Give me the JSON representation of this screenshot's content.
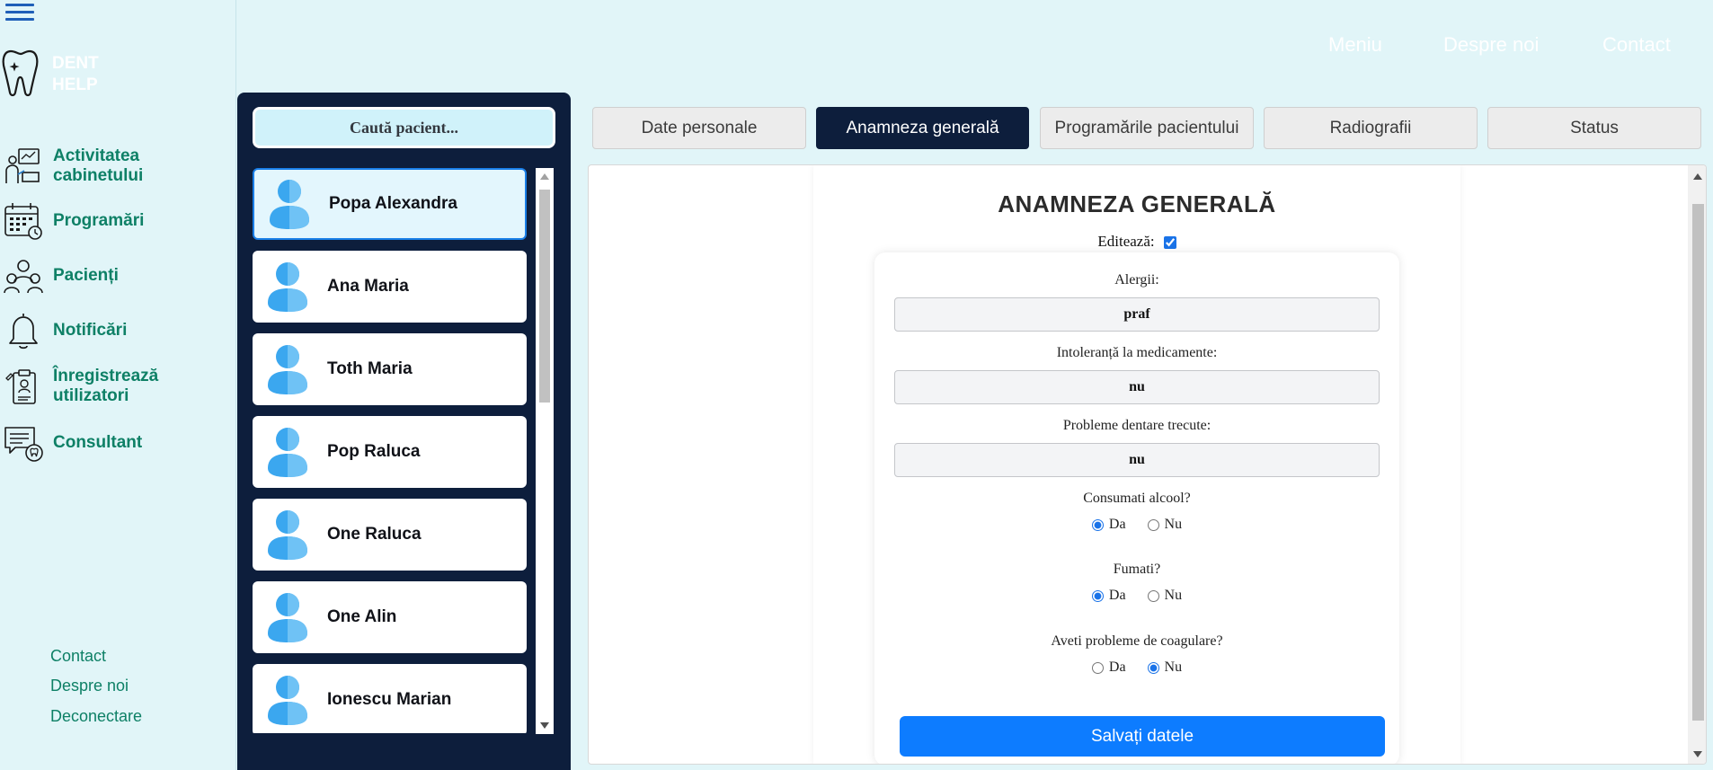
{
  "app": {
    "logo_line1": "DENT",
    "logo_line2": "HELP"
  },
  "topnav": {
    "menu": "Meniu",
    "about": "Despre noi",
    "contact": "Contact"
  },
  "sidebar": {
    "items": [
      {
        "label": "Activitatea cabinetului",
        "icon": "clinic-activity-icon"
      },
      {
        "label": "Programări",
        "icon": "calendar-icon"
      },
      {
        "label": "Pacienți",
        "icon": "patients-icon"
      },
      {
        "label": "Notificări",
        "icon": "bell-icon"
      },
      {
        "label": "Înregistrează utilizatori",
        "icon": "register-users-icon"
      },
      {
        "label": "Consultant",
        "icon": "consultant-icon"
      }
    ],
    "footer_links": [
      "Contact",
      "Despre noi",
      "Deconectare"
    ]
  },
  "patients": {
    "search_placeholder": "Caută pacient...",
    "list": [
      {
        "name": "Popa Alexandra",
        "selected": true
      },
      {
        "name": "Ana Maria",
        "selected": false
      },
      {
        "name": "Toth Maria",
        "selected": false
      },
      {
        "name": "Pop Raluca",
        "selected": false
      },
      {
        "name": "One Raluca",
        "selected": false
      },
      {
        "name": "One Alin",
        "selected": false
      },
      {
        "name": "Ionescu Marian",
        "selected": false
      }
    ]
  },
  "tabs": [
    {
      "label": "Date personale",
      "active": false
    },
    {
      "label": "Anamneza generală",
      "active": true
    },
    {
      "label": "Programările pacientului",
      "active": false
    },
    {
      "label": "Radiografii",
      "active": false
    },
    {
      "label": "Status",
      "active": false
    }
  ],
  "form": {
    "title": "ANAMNEZA GENERALĂ",
    "edit_label": "Editează:",
    "edit_checked": true,
    "fields": [
      {
        "label": "Alergii:",
        "value": "praf"
      },
      {
        "label": "Intoleranță la medicamente:",
        "value": "nu"
      },
      {
        "label": "Probleme dentare trecute:",
        "value": "nu"
      }
    ],
    "questions": [
      {
        "label": "Consumati alcool?",
        "yes": "Da",
        "no": "Nu",
        "answer": "Da"
      },
      {
        "label": "Fumati?",
        "yes": "Da",
        "no": "Nu",
        "answer": "Da"
      },
      {
        "label": "Aveti probleme de coagulare?",
        "yes": "Da",
        "no": "Nu",
        "answer": "Nu"
      }
    ],
    "save_label": "Salvați datele"
  },
  "colors": {
    "background": "#e1f5f8",
    "navy": "#0d1e3c",
    "accent_green": "#0e8066",
    "primary_blue": "#0d7cff"
  }
}
